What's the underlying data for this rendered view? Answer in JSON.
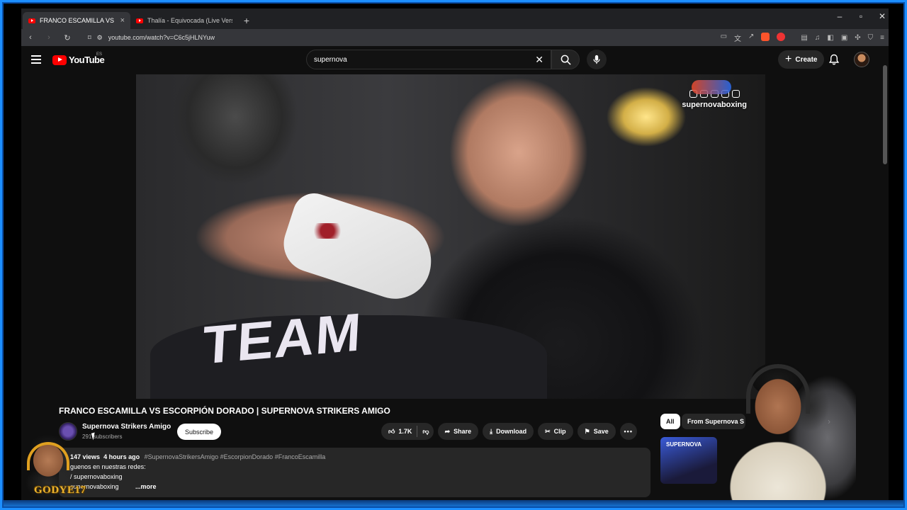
{
  "browser": {
    "tabs": [
      {
        "title": "FRANCO ESCAMILLA VS ESC",
        "active": true
      },
      {
        "title": "Thalía - Equivocada (Live Version) - Y",
        "active": false
      }
    ],
    "new_tab": "+",
    "url": "youtube.com/watch?v=C6c5jHLNYuw",
    "window_controls": {
      "minimize": "–",
      "restore": "▫",
      "close": "✕"
    }
  },
  "masthead": {
    "logo_text": "YouTube",
    "region": "ES",
    "search_query": "supernova",
    "create_label": "Create"
  },
  "video": {
    "jersey_text": "TEAM",
    "watermark_handle": "supernovaboxing"
  },
  "watch": {
    "title": "FRANCO ESCAMILLA VS ESCORPIÓN DORADO | SUPERNOVA STRIKERS AMIGO",
    "channel_name": "Supernova Strikers Amigo",
    "subscribers": "291 subscribers",
    "subscribe_label": "Subscribe",
    "actions": {
      "likes": "1.7K",
      "share": "Share",
      "download": "Download",
      "clip": "Clip",
      "save": "Save"
    },
    "description": {
      "views": "147 views",
      "age": "4 hours ago",
      "tags": "#SupernovaStrikersAmigo #EscorpionDorado #FrancoEscamilla",
      "line1": "guenos en nuestras redes:",
      "line2": "/ supernovaboxing",
      "line3": "supernovaboxing",
      "more": "...more"
    }
  },
  "sidebar": {
    "chips": [
      "All",
      "From Supernova S"
    ],
    "thumb_text": "SUPERNOVA"
  },
  "overlay": {
    "streamer_tag": "GODYE17"
  },
  "colors": {
    "yt_red": "#ff0000",
    "frame_blue": "#1d8fff",
    "gold": "#e8b230"
  }
}
